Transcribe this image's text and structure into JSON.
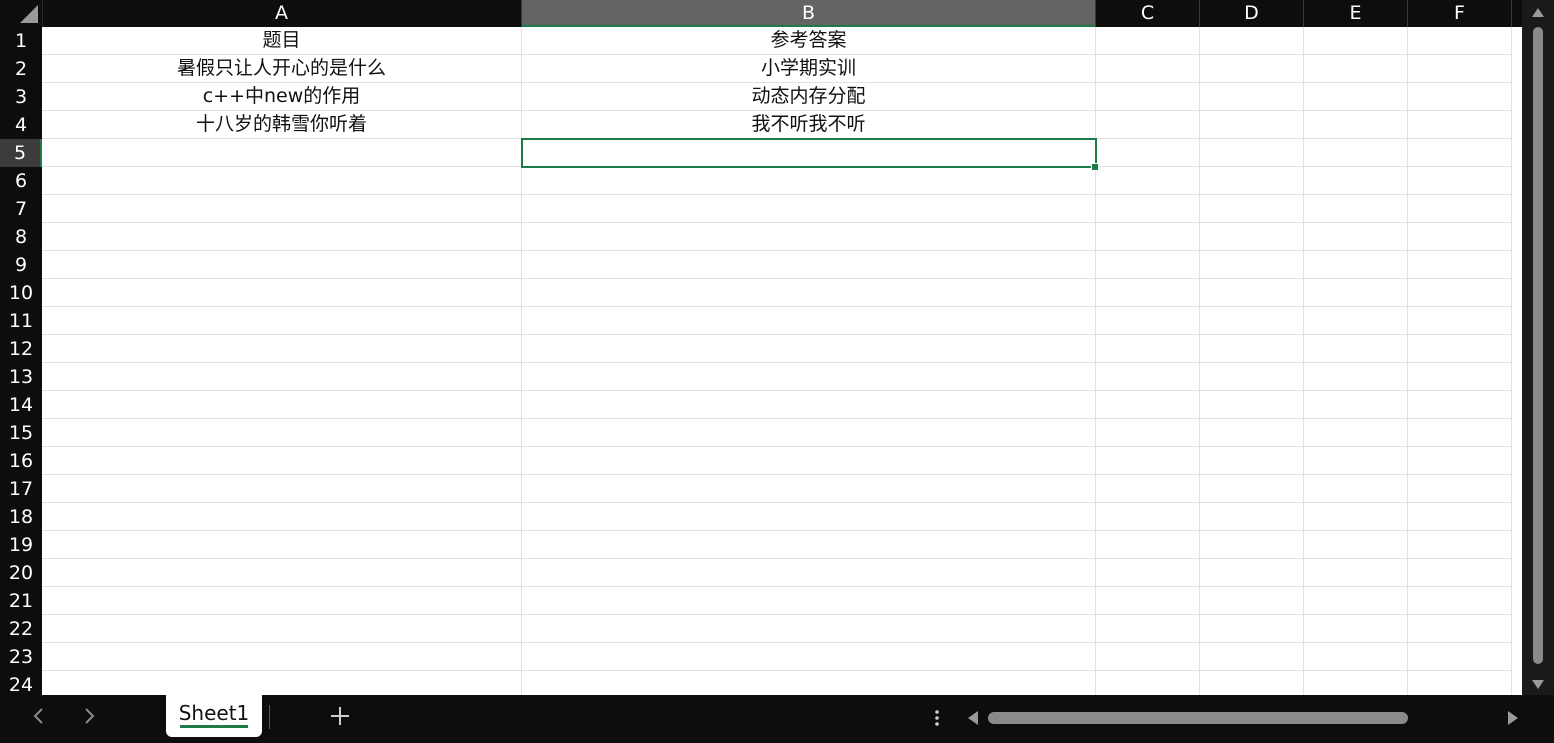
{
  "columns": [
    "A",
    "B",
    "C",
    "D",
    "E",
    "F"
  ],
  "selected_column": "B",
  "rows": [
    "1",
    "2",
    "3",
    "4",
    "5",
    "6",
    "7",
    "8",
    "9",
    "10",
    "11",
    "12",
    "13",
    "14",
    "15",
    "16",
    "17",
    "18",
    "19",
    "20",
    "21",
    "22",
    "23",
    "24"
  ],
  "selected_row": "5",
  "cells": {
    "A1": "题目",
    "B1": "参考答案",
    "A2": "暑假只让人开心的是什么",
    "B2": "小学期实训",
    "A3": "c++中new的作用",
    "B3": "动态内存分配",
    "A4": "十八岁的韩雪你听着",
    "B4": "我不听我不听"
  },
  "active_cell": "B5",
  "sheet_tabs": [
    {
      "label": "Sheet1",
      "active": true
    }
  ],
  "colors": {
    "accent": "#1e7a46",
    "header_bg": "#0d0d0d",
    "selected_col_header": "#646464"
  }
}
